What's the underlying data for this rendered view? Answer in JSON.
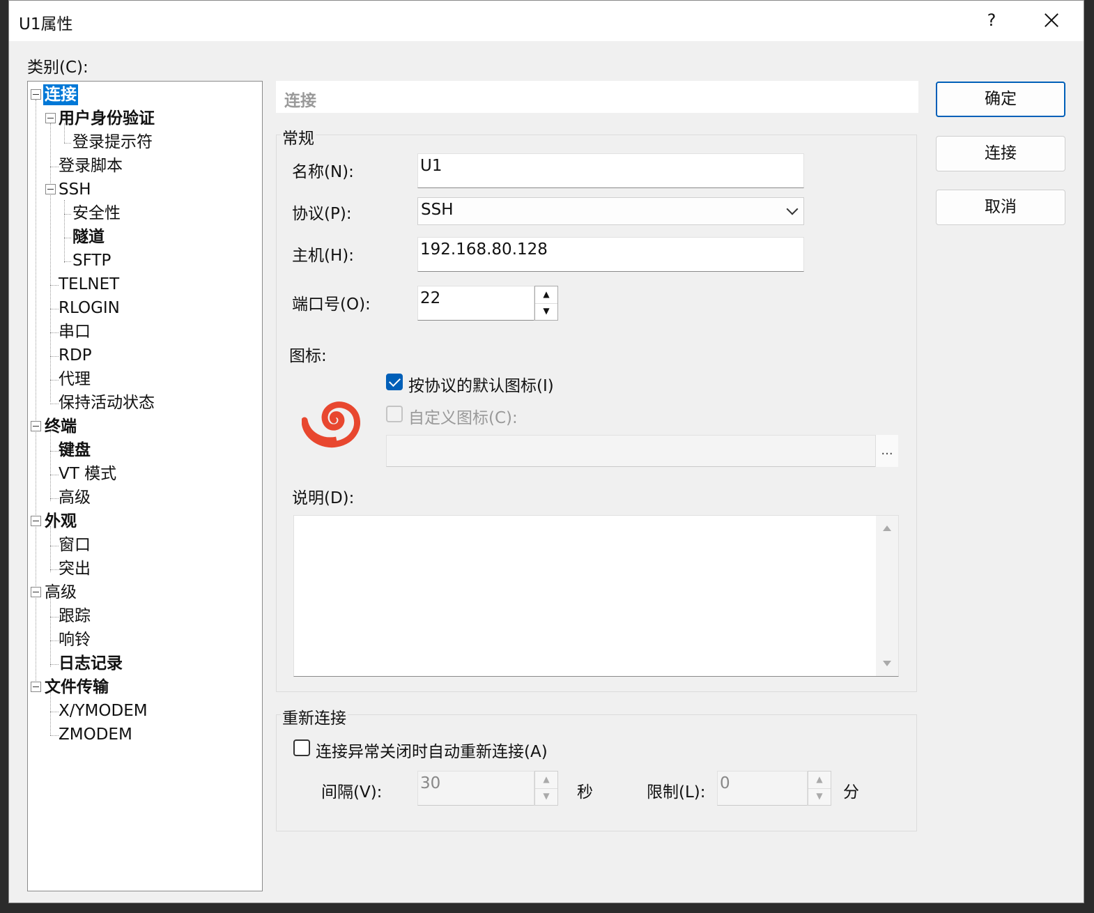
{
  "window": {
    "title": "U1属性",
    "help": "?",
    "close_label": ""
  },
  "category_label": "类别(C):",
  "tree": [
    {
      "label": "连接",
      "bold": true,
      "selected": true
    },
    {
      "label": "用户身份验证",
      "bold": true
    },
    {
      "label": "登录提示符"
    },
    {
      "label": "登录脚本"
    },
    {
      "label": "SSH"
    },
    {
      "label": "安全性"
    },
    {
      "label": "隧道",
      "bold": true
    },
    {
      "label": "SFTP"
    },
    {
      "label": "TELNET"
    },
    {
      "label": "RLOGIN"
    },
    {
      "label": "串口"
    },
    {
      "label": "RDP"
    },
    {
      "label": "代理"
    },
    {
      "label": "保持活动状态"
    },
    {
      "label": "终端",
      "bold": true
    },
    {
      "label": "键盘",
      "bold": true
    },
    {
      "label": "VT 模式"
    },
    {
      "label": "高级"
    },
    {
      "label": "外观",
      "bold": true
    },
    {
      "label": "窗口"
    },
    {
      "label": "突出"
    },
    {
      "label": "高级"
    },
    {
      "label": "跟踪"
    },
    {
      "label": "响铃"
    },
    {
      "label": "日志记录",
      "bold": true
    },
    {
      "label": "文件传输",
      "bold": true
    },
    {
      "label": "X/YMODEM"
    },
    {
      "label": "ZMODEM"
    }
  ],
  "panel": {
    "header": "连接",
    "general": {
      "title": "常规",
      "name_label": "名称(N):",
      "name_value": "U1",
      "protocol_label": "协议(P):",
      "protocol_value": "SSH",
      "host_label": "主机(H):",
      "host_value": "192.168.80.128",
      "port_label": "端口号(O):",
      "port_value": "22",
      "icon_label": "图标:",
      "default_icon_label": "按协议的默认图标(I)",
      "default_icon_checked": true,
      "custom_icon_label": "自定义图标(C):",
      "custom_icon_checked": false,
      "browse_label": "...",
      "description_label": "说明(D):"
    },
    "reconnect": {
      "title": "重新连接",
      "auto_label": "连接异常关闭时自动重新连接(A)",
      "auto_checked": false,
      "interval_label": "间隔(V):",
      "interval_value": "30",
      "interval_unit": "秒",
      "limit_label": "限制(L):",
      "limit_value": "0",
      "limit_unit": "分"
    }
  },
  "buttons": {
    "ok": "确定",
    "connect": "连接",
    "cancel": "取消"
  },
  "colors": {
    "accent": "#005fb8",
    "selection": "#0078d7",
    "logo": "#e8472f"
  }
}
